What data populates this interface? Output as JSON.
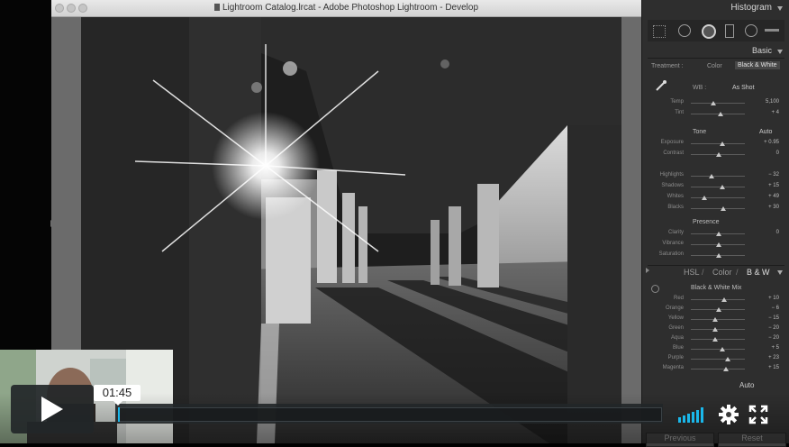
{
  "window": {
    "title": "Lightroom Catalog.lrcat - Adobe Photoshop Lightroom - Develop"
  },
  "panel": {
    "histogram_label": "Histogram",
    "basic_label": "Basic",
    "treatment_label": "Treatment :",
    "treatment_options": [
      "Color",
      "Black & White"
    ],
    "treatment_selected": "Black & White",
    "wb_label": "WB :",
    "wb_value": "As Shot",
    "wb_rows": [
      {
        "label": "Temp",
        "value": "5,100"
      },
      {
        "label": "Tint",
        "value": "+ 4"
      }
    ],
    "tone_label": "Tone",
    "auto_label": "Auto",
    "tone_rows": [
      {
        "label": "Exposure",
        "value": "+ 0.95"
      },
      {
        "label": "Contrast",
        "value": "0"
      },
      {
        "label": "Highlights",
        "value": "− 32"
      },
      {
        "label": "Shadows",
        "value": "+ 15"
      },
      {
        "label": "Whites",
        "value": "+ 49"
      },
      {
        "label": "Blacks",
        "value": "+ 30"
      }
    ],
    "presence_label": "Presence",
    "presence_rows": [
      {
        "label": "Clarity",
        "value": "0"
      },
      {
        "label": "Vibrance",
        "value": ""
      },
      {
        "label": "Saturation",
        "value": ""
      }
    ],
    "hsl_tabs": [
      "HSL",
      "Color",
      "B & W"
    ],
    "bw_mix_label": "Black & White Mix",
    "bw_rows": [
      {
        "label": "Red",
        "value": "+ 10"
      },
      {
        "label": "Orange",
        "value": "− 6"
      },
      {
        "label": "Yellow",
        "value": "− 15"
      },
      {
        "label": "Green",
        "value": "− 20"
      },
      {
        "label": "Aqua",
        "value": "− 20"
      },
      {
        "label": "Blue",
        "value": "+ 5"
      },
      {
        "label": "Purple",
        "value": "+ 23"
      },
      {
        "label": "Magenta",
        "value": "+ 15"
      }
    ],
    "bw_auto_label": "Auto",
    "previous_label": "Previous",
    "reset_label": "Reset"
  },
  "video": {
    "time": "01:45",
    "progress_fraction": 0.003,
    "colors": {
      "accent": "#1ab7ea",
      "control_bg": "#222628"
    }
  }
}
